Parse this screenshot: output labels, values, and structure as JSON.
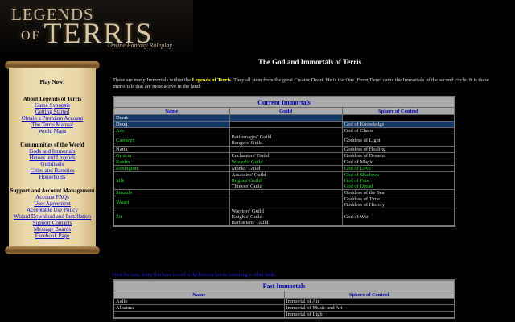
{
  "logo": {
    "line1": "LEGENDS",
    "of": "OF",
    "line2": "TERRIS",
    "tagline": "Online Fantasy Roleplay"
  },
  "sidebar": {
    "play_now": "Play Now!",
    "about_heading": "About Legends of Terris",
    "about_links": [
      "Game Synopsis",
      "Getting Started",
      "Obtain a Premium Account",
      "The Terris Manual",
      "World Maps"
    ],
    "communities_heading": "Communities of the World",
    "communities_links": [
      "Gods and Immortals",
      "Heroes and Legends",
      "Guildhalls",
      "Cities and Baronies",
      "Households"
    ],
    "support_heading": "Support and Account Management",
    "support_links": [
      "Account FAQs",
      "User Agreement",
      "Acceptable Use Policy",
      "Wizard Download and Installation",
      "Support Contacts",
      "Message Boards",
      "Facebook Page"
    ]
  },
  "page": {
    "title": "The God and Immortals of Terris",
    "intro_pre": "There are many Immortals within the ",
    "intro_hl": "Legends of Terris",
    "intro_post": ". They all stem from the great Creator Deori. He is the One. From Deori came the Immortals of the second circle. It is these Immortals that are most active in the land:"
  },
  "current": {
    "caption": "Current Immortals",
    "headers": [
      "Name",
      "Guild",
      "Sphere of Control"
    ],
    "rows": [
      {
        "name": "Deori",
        "guild": [],
        "sphere": [],
        "style": "sel",
        "gcolor": "white",
        "scolor": "white"
      },
      {
        "name": "Doug",
        "guild": [],
        "sphere": [
          "God of Knowledge"
        ],
        "style": "sel2",
        "gcolor": "white",
        "scolor": "white"
      },
      {
        "name": "Axs",
        "guild": [],
        "sphere": [
          "God of Chaos"
        ],
        "style": "green",
        "gcolor": "white",
        "scolor": "white"
      },
      {
        "name": "Caerwyn",
        "guild": [
          "Battlemages' Guild",
          "Rangers' Guild"
        ],
        "sphere": [
          "Goddess of Light"
        ],
        "style": "green",
        "gcolor": "white",
        "scolor": "white"
      },
      {
        "name": "Naria",
        "guild": [],
        "sphere": [
          "Goddess of Healing"
        ],
        "style": "white",
        "gcolor": "white",
        "scolor": "white"
      },
      {
        "name": "Ornicat",
        "guild": [
          "Enchanters' Guild"
        ],
        "sphere": [
          "Goddess of Dreams"
        ],
        "style": "green",
        "gcolor": "white",
        "scolor": "white"
      },
      {
        "name": "Raidin",
        "guild": [
          "Wizards' Guild"
        ],
        "sphere": [
          "God of Magic"
        ],
        "style": "green",
        "gcolor": "green",
        "scolor": "white"
      },
      {
        "name": "Rexington",
        "guild": [
          "Monks' Guild"
        ],
        "sphere": [
          "God of Love"
        ],
        "style": "green",
        "gcolor": "white",
        "scolor": "green"
      },
      {
        "name": "Silk",
        "guild": [
          "Assassins' Guild",
          "Rogues' Guild",
          "Thieves' Guild"
        ],
        "sphere": [
          "God of Shadows",
          "God of Fate",
          "God of Dread"
        ],
        "style": "green",
        "gcolor": "mixed",
        "scolor": "green"
      },
      {
        "name": "Snazzle",
        "guild": [],
        "sphere": [
          "Goddess of the Sea"
        ],
        "style": "green",
        "gcolor": "white",
        "scolor": "white"
      },
      {
        "name": "Vasari",
        "guild": [],
        "sphere": [
          "Goddess of Time",
          "Goddess of History"
        ],
        "style": "green",
        "gcolor": "white",
        "scolor": "white"
      },
      {
        "name": "Zit",
        "guild": [
          "Warriors' Guild",
          "Knights' Guild",
          "Barbarians' Guild"
        ],
        "sphere": [
          "God of War"
        ],
        "style": "green",
        "gcolor": "white",
        "scolor": "white"
      }
    ]
  },
  "past_note": "Over the eons, many that have served in the heavens before vanishing to other lands.",
  "past": {
    "caption": "Past Immortals",
    "headers": [
      "Name",
      "Sphere of Control"
    ],
    "rows": [
      {
        "name": "Aello",
        "sphere": "Immortal of Air"
      },
      {
        "name": "Alhanna",
        "sphere": "Immortal of Music and Art"
      },
      {
        "name": "",
        "sphere": "Immortal of Light"
      }
    ]
  },
  "colors": {
    "accent": "#ffff00",
    "link": "#0000cc",
    "green": "#22dd22",
    "selected": "#153a6a",
    "header_bg": "#aaaaaa"
  }
}
